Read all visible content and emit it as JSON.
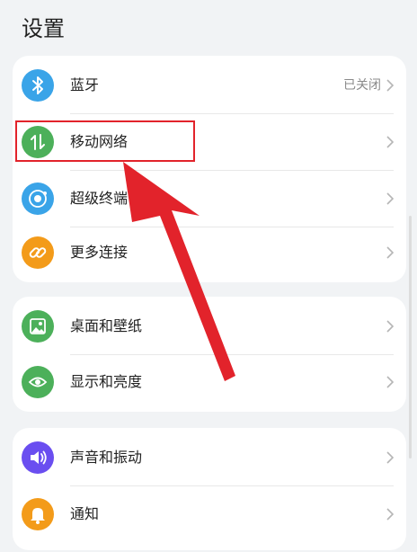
{
  "page": {
    "title": "设置"
  },
  "groups": [
    {
      "items": [
        {
          "label": "蓝牙",
          "value": "已关闭",
          "icon": "bluetooth-icon",
          "color": "#3aa4e8"
        },
        {
          "label": "移动网络",
          "icon": "mobile-data-icon",
          "color": "#4cb05a"
        },
        {
          "label": "超级终端",
          "icon": "super-device-icon",
          "color": "#3aa4e8"
        },
        {
          "label": "更多连接",
          "icon": "link-icon",
          "color": "#f39b1a"
        }
      ]
    },
    {
      "items": [
        {
          "label": "桌面和壁纸",
          "icon": "wallpaper-icon",
          "color": "#4cb05a"
        },
        {
          "label": "显示和亮度",
          "icon": "eye-icon",
          "color": "#4cb05a"
        }
      ]
    },
    {
      "items": [
        {
          "label": "声音和振动",
          "icon": "speaker-icon",
          "color": "#6a4ef0"
        },
        {
          "label": "通知",
          "icon": "bell-icon",
          "color": "#f39b1a"
        }
      ]
    }
  ],
  "annotation": {
    "color": "#e2232b"
  }
}
